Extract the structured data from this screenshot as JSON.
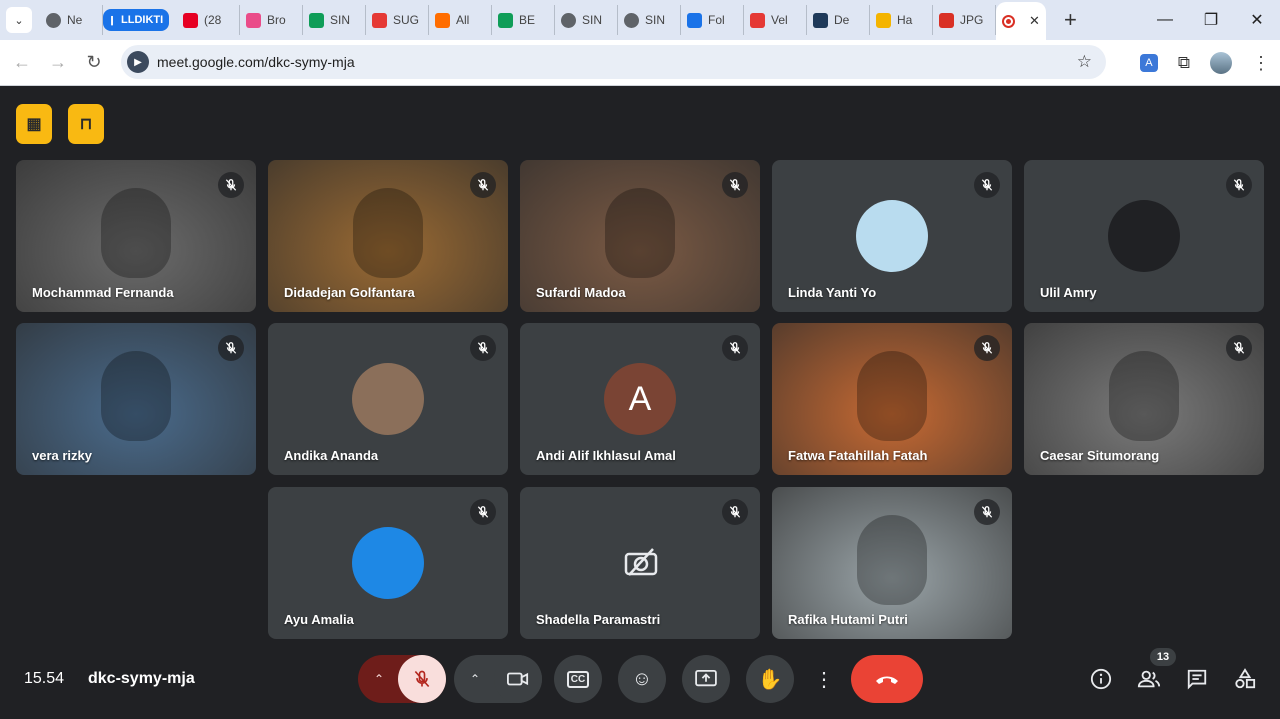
{
  "browser": {
    "tabs": [
      {
        "label": "Ne",
        "color": "#5f6368",
        "icon": "globe-icon"
      },
      {
        "label": "LLDIKTI",
        "color": "#1a73e8",
        "icon": "group-icon"
      },
      {
        "label": "(28",
        "color": "#e60023",
        "icon": "pinterest-icon"
      },
      {
        "label": "Bro",
        "color": "#ea4c89",
        "icon": "dribbble-icon"
      },
      {
        "label": "SIN",
        "color": "#0f9d58",
        "icon": "sheets-icon"
      },
      {
        "label": "SUG",
        "color": "#e53935",
        "icon": "arrow-logo-icon"
      },
      {
        "label": "All",
        "color": "#ff6d00",
        "icon": "clickup-icon"
      },
      {
        "label": "BE",
        "color": "#0f9d58",
        "icon": "sheets-icon"
      },
      {
        "label": "SIN",
        "color": "#5f6368",
        "icon": "globe-icon"
      },
      {
        "label": "SIN",
        "color": "#5f6368",
        "icon": "globe-icon"
      },
      {
        "label": "Fol",
        "color": "#1a73e8",
        "icon": "form-icon"
      },
      {
        "label": "Vel",
        "color": "#e53935",
        "icon": "vel-icon"
      },
      {
        "label": "De",
        "color": "#1f3a5a",
        "icon": "shield-icon"
      },
      {
        "label": "Ha",
        "color": "#f4b400",
        "icon": "hat-icon"
      },
      {
        "label": "JPG",
        "color": "#d93025",
        "icon": "jpg-icon"
      }
    ],
    "active_tab_icon": "record-icon",
    "url": "meet.google.com/dkc-symy-mja"
  },
  "participants": [
    {
      "name": "Mochammad Fernanda",
      "bg": "#6b6b6b",
      "type": "video"
    },
    {
      "name": "Didadejan Golfantara",
      "bg": "#9a6a33",
      "type": "video"
    },
    {
      "name": "Sufardi Madoa",
      "bg": "#7b5a44",
      "type": "video"
    },
    {
      "name": "Linda Yanti Yo",
      "bg": "#3c4043",
      "type": "avatar-image",
      "avatar_color": "#b9dcef"
    },
    {
      "name": "Ulil Amry",
      "bg": "#3c4043",
      "type": "avatar-image",
      "avatar_color": "#202124"
    },
    {
      "name": "vera rizky",
      "bg": "#4a6b8c",
      "type": "video"
    },
    {
      "name": "Andika Ananda",
      "bg": "#3c4043",
      "type": "avatar-image",
      "avatar_color": "#8b6f5a"
    },
    {
      "name": "Andi Alif Ikhlasul Amal",
      "bg": "#3c4043",
      "type": "avatar-letter",
      "letter": "A",
      "avatar_color": "#7a4434"
    },
    {
      "name": "Fatwa Fatahillah Fatah",
      "bg": "#c76a33",
      "type": "video"
    },
    {
      "name": "Caesar Situmorang",
      "bg": "#7a7a7a",
      "type": "video"
    },
    {
      "name": "Ayu Amalia",
      "bg": "#3c4043",
      "type": "avatar-image",
      "avatar_color": "#1e88e5"
    },
    {
      "name": "Shadella Paramastri",
      "bg": "#3c4043",
      "type": "camera-off"
    },
    {
      "name": "Rafika Hutami Putri",
      "bg": "#9aa4a8",
      "type": "video"
    }
  ],
  "meeting": {
    "time": "15.54",
    "code": "dkc-symy-mja",
    "participant_count": "13"
  },
  "colors": {
    "accent": "#f9b912",
    "end_call": "#ea4335",
    "mic_off": "#f9dedc"
  }
}
